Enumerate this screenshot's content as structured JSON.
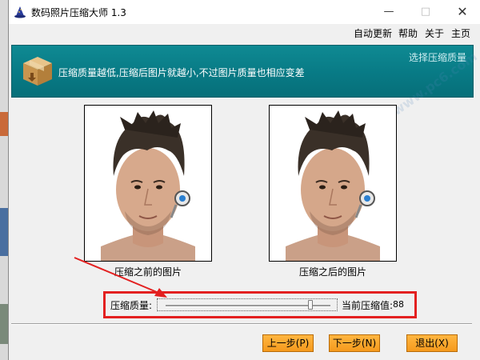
{
  "window": {
    "title": "数码照片压缩大师 1.3",
    "controls": {
      "minimize": "—",
      "maximize": "□",
      "close": "✕"
    }
  },
  "menu": {
    "items": [
      "自动更新",
      "帮助",
      "关于",
      "主页"
    ]
  },
  "banner": {
    "description": "压缩质量越低,压缩后图片就越小,不过图片质量也相应变差",
    "step_title": "选择压缩质量",
    "icon": "package-box-icon"
  },
  "photos": {
    "before_label": "压缩之前的图片",
    "after_label": "压缩之后的图片"
  },
  "compression": {
    "quality_label": "压缩质量:",
    "current_label": "当前压缩值:",
    "current_value": "88",
    "slider_fraction": 0.88
  },
  "buttons": {
    "prev": "上一步(P)",
    "next": "下一步(N)",
    "exit": "退出(X)"
  },
  "colors": {
    "banner": "#0a7f8a",
    "button": "#f5a02a",
    "highlight": "#e32020"
  }
}
